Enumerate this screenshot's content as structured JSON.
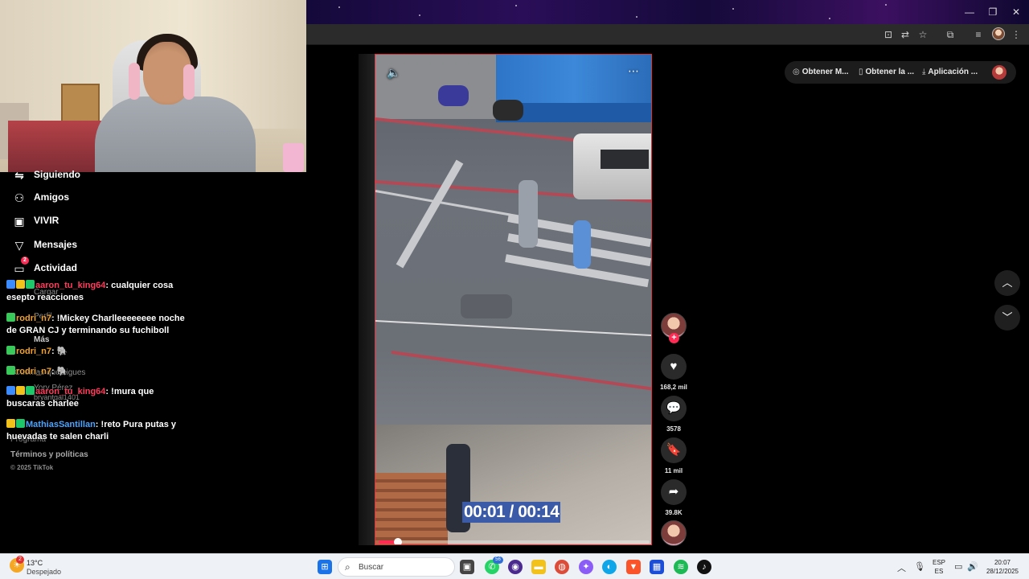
{
  "browser": {
    "window_controls": [
      "—",
      "❐",
      "✕"
    ],
    "toolbar_icons": [
      "screenshot-icon",
      "translate-icon",
      "bookmark-star-icon",
      "extensions-icon",
      "media-control-icon",
      "profile-avatar",
      "menu-kebab-icon"
    ]
  },
  "sidebar": {
    "items": [
      {
        "label": "Siguiendo",
        "icon": "following-icon",
        "glyph": "⇋"
      },
      {
        "label": "Amigos",
        "icon": "friends-icon",
        "glyph": "👥"
      },
      {
        "label": "VIVIR",
        "icon": "live-icon",
        "glyph": "▣"
      },
      {
        "label": "Mensajes",
        "icon": "messages-icon",
        "glyph": "▽"
      },
      {
        "label": "Actividad",
        "icon": "activity-icon",
        "glyph": "▭",
        "badge": "2"
      }
    ],
    "ghost_items": [
      "Cargar",
      "Perfil",
      "Más",
      "Cuentas que sigues",
      "Yory Pérez",
      "bryantgal1401",
      "Programa"
    ],
    "footer_terms": "Términos y políticas",
    "footer_copy": "© 2025 TikTok"
  },
  "chat": [
    {
      "user": "aaron_tu_king64",
      "text": "cualquier cosa esepto reacciones",
      "color": "red"
    },
    {
      "user": "rodri_n7",
      "text": "!Mickey Charlleeeeeeee noche de GRAN CJ y terminando su fuchiboll",
      "color": "orange"
    },
    {
      "user": "rodri_n7",
      "text": "🐘",
      "color": "orange"
    },
    {
      "user": "rodri_n7",
      "text": "🐘",
      "color": "orange"
    },
    {
      "user": "aaron_tu_king64",
      "text": "!mura que buscaras charlee",
      "color": "red"
    },
    {
      "user": "MathiasSantillan",
      "text": "!reto Pura putas y huevadas te salen charli",
      "color": "blue"
    }
  ],
  "video": {
    "timestamp": "00:01 / 00:14",
    "progress": 0.07,
    "volume_icon": "volume-icon",
    "more_icon": "more-options-icon"
  },
  "actions": {
    "likes": "168,2 mil",
    "comments": "3578",
    "saves": "11 mil",
    "shares": "39.8K"
  },
  "top_pill": {
    "items": [
      "Obtener M...",
      "Obtener la ...",
      "Aplicación ..."
    ],
    "icons": [
      "coin-icon",
      "phone-icon",
      "download-icon"
    ]
  },
  "taskbar": {
    "weather_temp": "13°C",
    "weather_desc": "Despejado",
    "weather_badge": "2",
    "search_placeholder": "Buscar",
    "whatsapp_badge": "56",
    "lang_top": "ESP",
    "lang_bottom": "ES",
    "time": "20:07",
    "date": "28/12/2025"
  }
}
